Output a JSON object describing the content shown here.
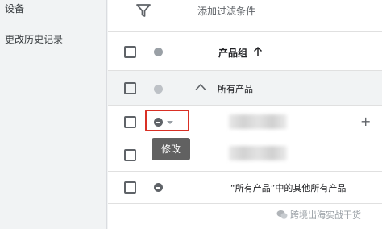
{
  "sidebar": {
    "items": [
      {
        "label": "设备"
      },
      {
        "label": "更改历史记录"
      }
    ]
  },
  "filter": {
    "icon": "filter-icon",
    "label": "添加过滤条件"
  },
  "table": {
    "column_header": "产品组",
    "sort": "ascending",
    "all_products_label": "所有产品",
    "other_products_label": "“所有产品”中的其他所有产品"
  },
  "tooltip": {
    "label": "修改"
  },
  "watermark": {
    "label": "跨境出海实战干货"
  },
  "colors": {
    "highlight": "#d93025",
    "tooltip_bg": "#616161",
    "status_gray": "#9aa0a6"
  }
}
